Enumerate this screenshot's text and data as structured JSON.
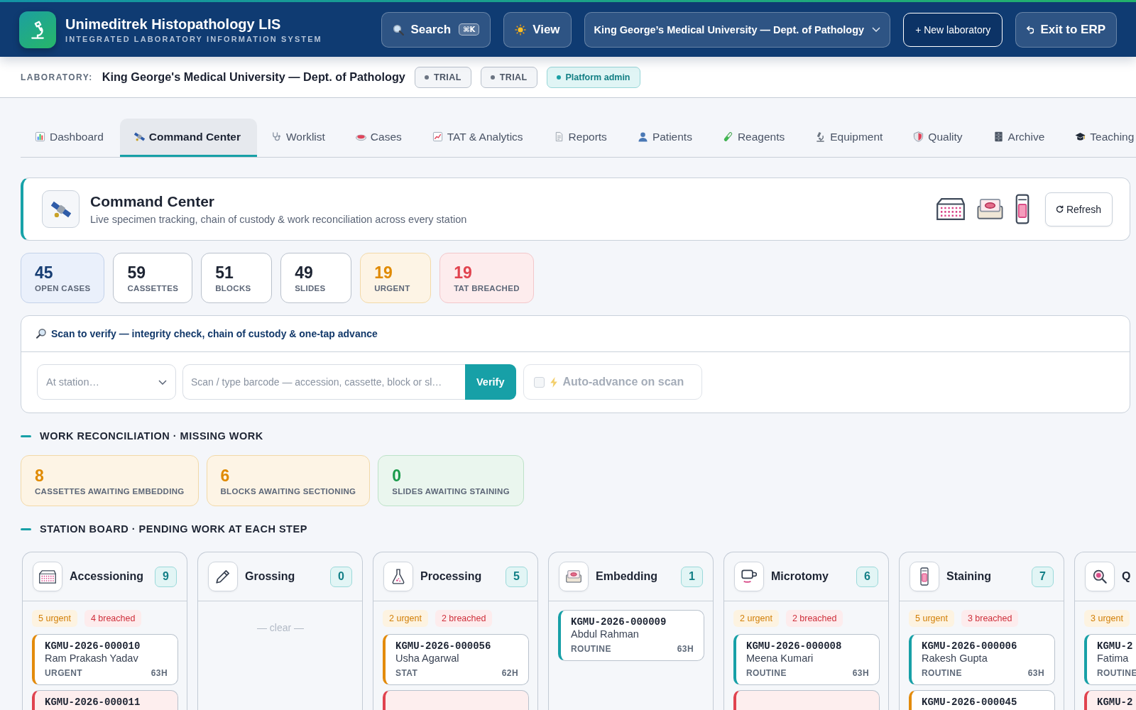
{
  "header": {
    "title": "Unimeditrek Histopathology LIS",
    "subtitle": "INTEGRATED LABORATORY INFORMATION SYSTEM",
    "search": {
      "label": "Search",
      "shortcut": "⌘K"
    },
    "view_button": "View",
    "lab_select": "King George’s Medical University — Dept. of Pathology",
    "new_lab_button": "+ New laboratory",
    "exit_button": "Exit to ERP"
  },
  "lab_bar": {
    "label": "LABORATORY:",
    "name": "King George's Medical University — Dept. of Pathology",
    "chips": [
      {
        "label": "TRIAL",
        "kind": "neutral"
      },
      {
        "label": "TRIAL",
        "kind": "neutral"
      },
      {
        "label": "Platform admin",
        "kind": "admin"
      }
    ]
  },
  "tabs": [
    {
      "label": "Dashboard",
      "selected": false
    },
    {
      "label": "Command Center",
      "selected": true
    },
    {
      "label": "Worklist",
      "selected": false
    },
    {
      "label": "Cases",
      "selected": false
    },
    {
      "label": "TAT & Analytics",
      "selected": false
    },
    {
      "label": "Reports",
      "selected": false
    },
    {
      "label": "Patients",
      "selected": false
    },
    {
      "label": "Reagents",
      "selected": false
    },
    {
      "label": "Equipment",
      "selected": false
    },
    {
      "label": "Quality",
      "selected": false
    },
    {
      "label": "Archive",
      "selected": false
    },
    {
      "label": "Teaching",
      "selected": false
    }
  ],
  "command_center": {
    "title": "Command Center",
    "subtitle": "Live specimen tracking, chain of custody & work reconciliation across every station",
    "refresh_button": "Refresh"
  },
  "stats": [
    {
      "value": "45",
      "label": "OPEN CASES",
      "kind": "info"
    },
    {
      "value": "59",
      "label": "CASSETTES",
      "kind": "plain"
    },
    {
      "value": "51",
      "label": "BLOCKS",
      "kind": "plain"
    },
    {
      "value": "49",
      "label": "SLIDES",
      "kind": "plain"
    },
    {
      "value": "19",
      "label": "URGENT",
      "kind": "warning"
    },
    {
      "value": "19",
      "label": "TAT BREACHED",
      "kind": "danger"
    }
  ],
  "scan": {
    "title": "Scan to verify — integrity check, chain of custody & one-tap advance",
    "station_select": {
      "placeholder": "At station…"
    },
    "barcode_field": {
      "placeholder": "Scan / type barcode — accession, cassette, block or sl…"
    },
    "verify_button": "Verify",
    "auto_advance": {
      "label": "Auto-advance on scan",
      "checked": false,
      "disabled": true
    }
  },
  "reconciliation": {
    "title": "WORK RECONCILIATION · MISSING WORK",
    "items": [
      {
        "value": "8",
        "label": "CASSETTES AWAITING EMBEDDING",
        "kind": "warning"
      },
      {
        "value": "6",
        "label": "BLOCKS AWAITING SECTIONING",
        "kind": "warning"
      },
      {
        "value": "0",
        "label": "SLIDES AWAITING STAINING",
        "kind": "success"
      }
    ]
  },
  "station_board": {
    "title": "STATION BOARD · PENDING WORK AT EACH STEP",
    "stations": [
      {
        "name": "Accessioning",
        "count": "9",
        "urgent": "5 urgent",
        "breached": "4 breached",
        "cases": [
          {
            "id": "KGMU-2026-000010",
            "patient": "Ram Prakash Yadav",
            "priority": "URGENT",
            "age": "63H",
            "kind": "urgent"
          },
          {
            "id": "KGMU-2026-000011",
            "kind": "breached"
          }
        ]
      },
      {
        "name": "Grossing",
        "count": "0",
        "empty": "— clear —"
      },
      {
        "name": "Processing",
        "count": "5",
        "urgent": "2 urgent",
        "breached": "2 breached",
        "cases": [
          {
            "id": "KGMU-2026-000056",
            "patient": "Usha Agarwal",
            "priority": "STAT",
            "age": "62H",
            "kind": "urgent"
          },
          {
            "kind": "breached"
          }
        ]
      },
      {
        "name": "Embedding",
        "count": "1",
        "cases": [
          {
            "id": "KGMU-2026-000009",
            "patient": "Abdul Rahman",
            "priority": "ROUTINE",
            "age": "63H",
            "kind": "routine"
          }
        ]
      },
      {
        "name": "Microtomy",
        "count": "6",
        "urgent": "2 urgent",
        "breached": "2 breached",
        "cases": [
          {
            "id": "KGMU-2026-000008",
            "patient": "Meena Kumari",
            "priority": "ROUTINE",
            "age": "63H",
            "kind": "routine"
          },
          {
            "kind": "breached"
          }
        ]
      },
      {
        "name": "Staining",
        "count": "7",
        "urgent": "5 urgent",
        "breached": "3 breached",
        "cases": [
          {
            "id": "KGMU-2026-000006",
            "patient": "Rakesh Gupta",
            "priority": "ROUTINE",
            "age": "63H",
            "kind": "routine"
          },
          {
            "id": "KGMU-2026-000045",
            "kind": "urgent"
          }
        ]
      },
      {
        "name": "Q",
        "urgent": "3 urgent",
        "cases": [
          {
            "id": "KGMU-2",
            "patient": "Fatima",
            "priority": "ROUTINE",
            "kind": "routine"
          },
          {
            "id": "KGMU-2",
            "kind": "breached"
          }
        ]
      }
    ]
  }
}
